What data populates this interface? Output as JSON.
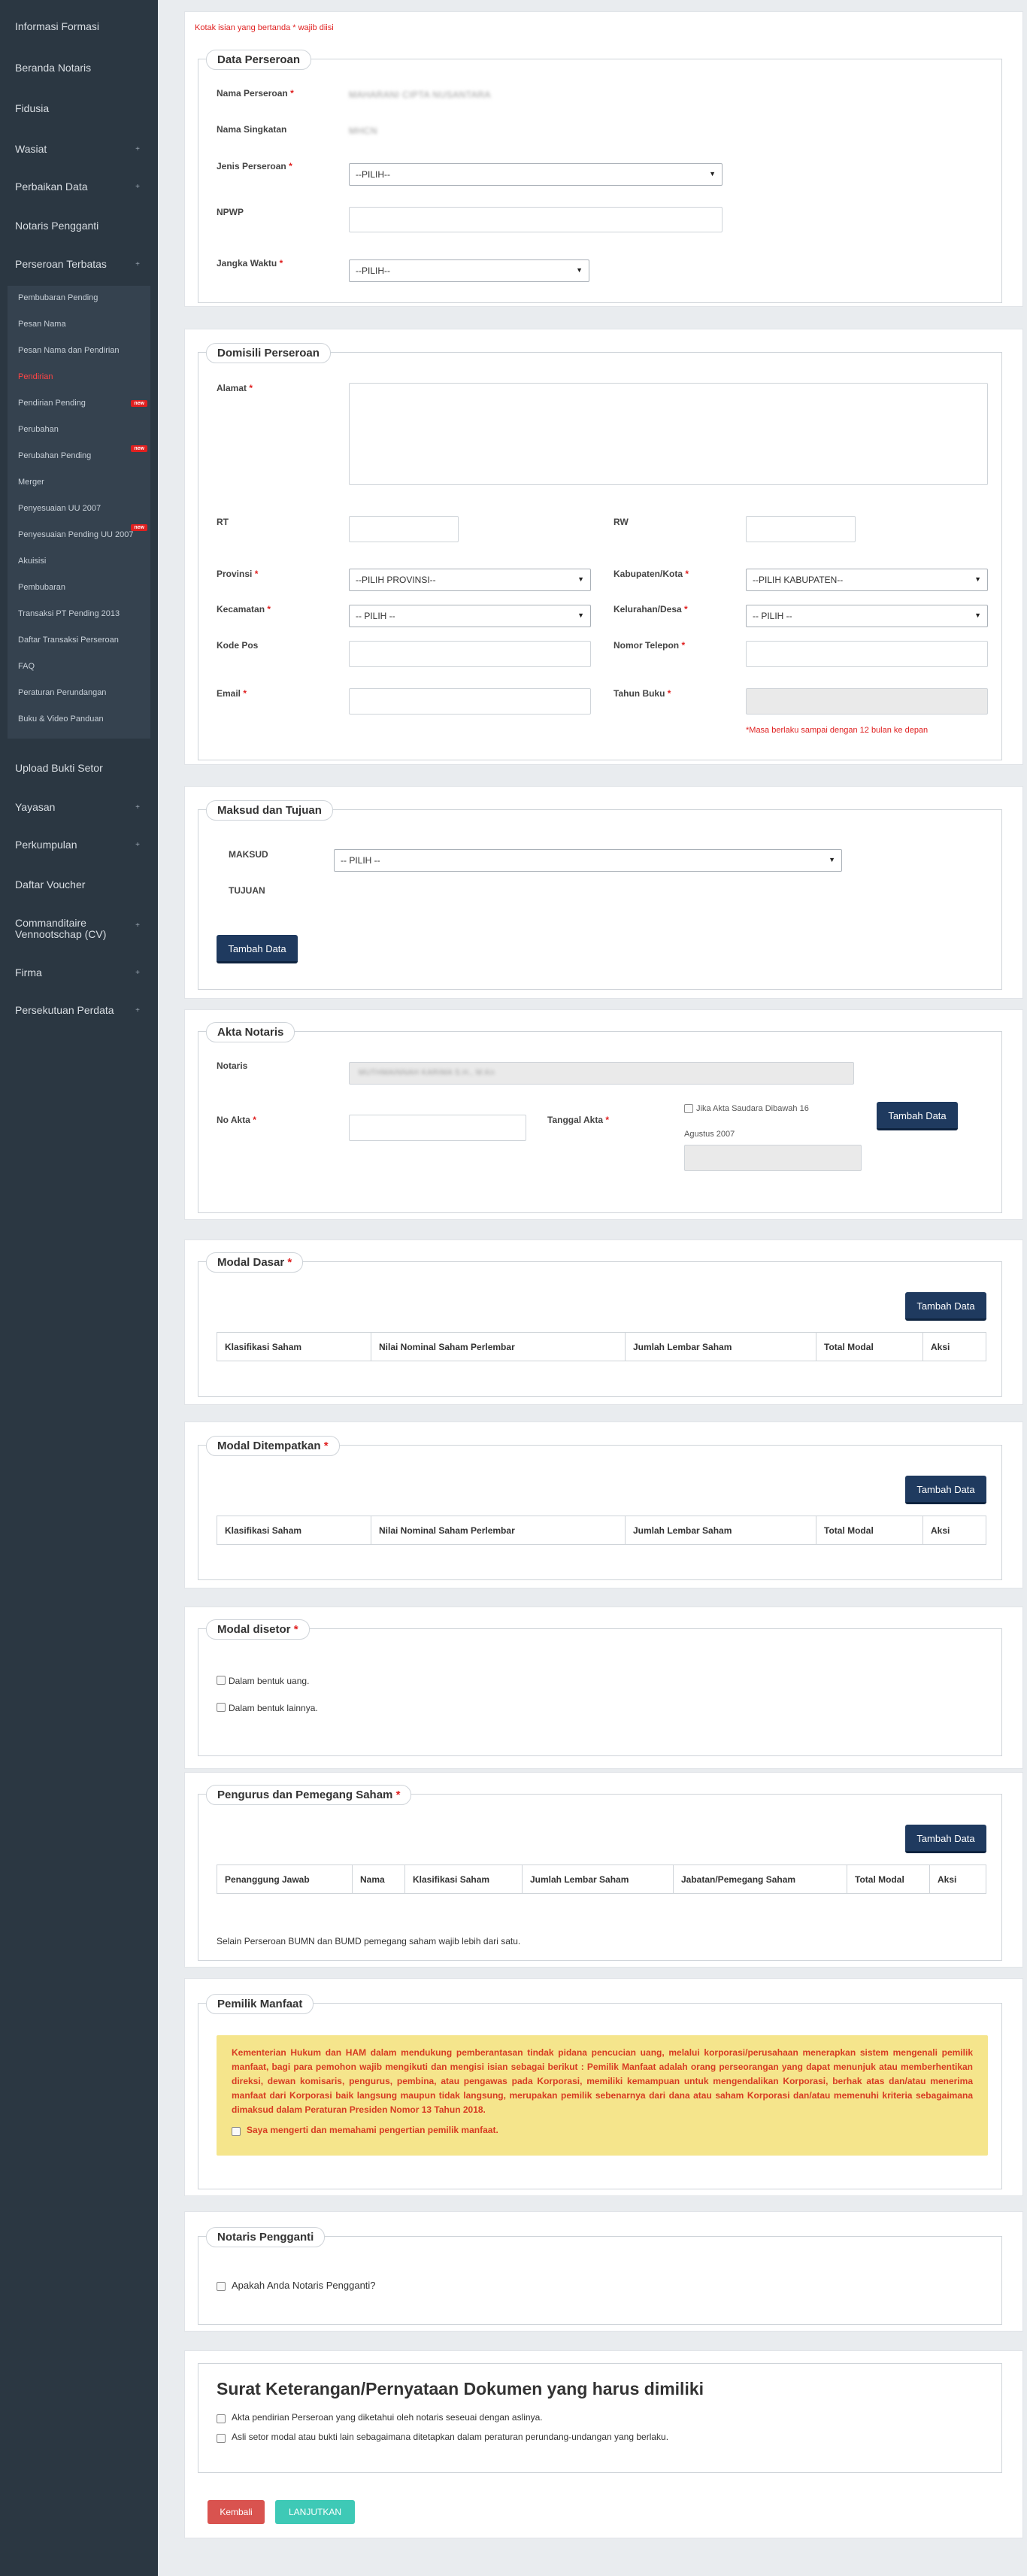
{
  "sidebar": {
    "items": [
      {
        "label": "Informasi Formasi",
        "chevron": false
      },
      {
        "label": "Beranda Notaris",
        "chevron": false
      },
      {
        "label": "Fidusia",
        "chevron": false
      },
      {
        "label": "Wasiat",
        "chevron": true
      },
      {
        "label": "Perbaikan Data",
        "chevron": true
      },
      {
        "label": "Notaris Pengganti",
        "chevron": false
      },
      {
        "label": "Perseroan Terbatas",
        "chevron": true
      }
    ],
    "submenu": [
      {
        "label": "Pembubaran Pending",
        "new": false,
        "active": false
      },
      {
        "label": "Pesan Nama",
        "new": false,
        "active": false
      },
      {
        "label": "Pesan Nama dan Pendirian",
        "new": false,
        "active": false
      },
      {
        "label": "Pendirian",
        "new": false,
        "active": true
      },
      {
        "label": "Pendirian Pending",
        "new": true,
        "active": false
      },
      {
        "label": "Perubahan",
        "new": false,
        "active": false
      },
      {
        "label": "Perubahan Pending",
        "new": true,
        "active": false
      },
      {
        "label": "Merger",
        "new": false,
        "active": false
      },
      {
        "label": "Penyesuaian UU 2007",
        "new": false,
        "active": false
      },
      {
        "label": "Penyesuaian Pending UU 2007",
        "new": true,
        "active": false
      },
      {
        "label": "Akuisisi",
        "new": false,
        "active": false
      },
      {
        "label": "Pembubaran",
        "new": false,
        "active": false
      },
      {
        "label": "Transaksi PT Pending 2013",
        "new": false,
        "active": false
      },
      {
        "label": "Daftar Transaksi Perseroan",
        "new": false,
        "active": false
      },
      {
        "label": "FAQ",
        "new": false,
        "active": false
      },
      {
        "label": "Peraturan Perundangan",
        "new": false,
        "active": false
      },
      {
        "label": "Buku & Video Panduan",
        "new": false,
        "active": false
      }
    ],
    "badge_label": "new",
    "items_after": [
      {
        "label": "Upload Bukti Setor",
        "chevron": false
      },
      {
        "label": "Yayasan",
        "chevron": true
      },
      {
        "label": "Perkumpulan",
        "chevron": true
      },
      {
        "label": "Daftar Voucher",
        "chevron": false
      },
      {
        "label": "Commanditaire Vennootschap (CV)",
        "chevron": true
      },
      {
        "label": "Firma",
        "chevron": true
      },
      {
        "label": "Persekutuan Perdata",
        "chevron": true
      }
    ]
  },
  "form": {
    "required_note": "Kotak isian yang bertanda * wajib diisi",
    "data_perseroan": {
      "legend": "Data Perseroan",
      "nama_label": "Nama Perseroan",
      "nama_value": "MAHARANI CIPTA NUSANTARA",
      "singkatan_label": "Nama Singkatan",
      "singkatan_value": "MHCN",
      "jenis_label": "Jenis Perseroan",
      "jenis_value": "--PILIH--",
      "npwp_label": "NPWP",
      "jangka_label": "Jangka Waktu",
      "jangka_value": "--PILIH--"
    },
    "domisili": {
      "legend": "Domisili Perseroan",
      "alamat_label": "Alamat",
      "rt_label": "RT",
      "rw_label": "RW",
      "provinsi_label": "Provinsi",
      "provinsi_value": "--PILIH PROVINSI--",
      "kabupaten_label": "Kabupaten/Kota",
      "kabupaten_value": "--PILIH KABUPATEN--",
      "kecamatan_label": "Kecamatan",
      "kecamatan_value": "-- PILIH --",
      "kelurahan_label": "Kelurahan/Desa",
      "kelurahan_value": "-- PILIH --",
      "kodepos_label": "Kode Pos",
      "telepon_label": "Nomor Telepon",
      "email_label": "Email",
      "tahunbuku_label": "Tahun Buku",
      "tahunbuku_note": "*Masa berlaku sampai dengan 12 bulan ke depan"
    },
    "maksud": {
      "legend": "Maksud dan Tujuan",
      "maksud_label": "MAKSUD",
      "maksud_value": "-- PILIH --",
      "tujuan_label": "TUJUAN",
      "add_button": "Tambah Data"
    },
    "akta": {
      "legend": "Akta Notaris",
      "notaris_label": "Notaris",
      "notaris_value": "MUTHMAINNAH KARIMA S.H., M.Kn",
      "noakta_label": "No Akta",
      "tanggal_label": "Tanggal Akta",
      "checkbox_label_line1": "Jika Akta Saudara Dibawah 16",
      "checkbox_label_line2": "Agustus 2007",
      "add_button": "Tambah Data"
    },
    "modal_dasar": {
      "legend": "Modal Dasar",
      "add_button": "Tambah Data",
      "columns": [
        "Klasifikasi Saham",
        "Nilai Nominal Saham Perlembar",
        "Jumlah Lembar Saham",
        "Total Modal",
        "Aksi"
      ]
    },
    "modal_ditempatkan": {
      "legend": "Modal Ditempatkan",
      "add_button": "Tambah Data",
      "columns": [
        "Klasifikasi Saham",
        "Nilai Nominal Saham Perlembar",
        "Jumlah Lembar Saham",
        "Total Modal",
        "Aksi"
      ]
    },
    "modal_disetor": {
      "legend": "Modal disetor",
      "opt_uang": "Dalam bentuk uang.",
      "opt_lainnya": "Dalam bentuk lainnya."
    },
    "pengurus": {
      "legend": "Pengurus dan Pemegang Saham",
      "add_button": "Tambah Data",
      "columns": [
        "Penanggung Jawab",
        "Nama",
        "Klasifikasi Saham",
        "Jumlah Lembar Saham",
        "Jabatan/Pemegang Saham",
        "Total Modal",
        "Aksi"
      ],
      "note": "Selain Perseroan BUMN dan BUMD pemegang saham wajib lebih dari satu."
    },
    "pemilik_manfaat": {
      "legend": "Pemilik Manfaat",
      "warning": "Kementerian Hukum dan HAM dalam mendukung pemberantasan tindak pidana pencucian uang, melalui korporasi/perusahaan menerapkan sistem mengenali pemilik manfaat, bagi para pemohon wajib mengikuti dan mengisi isian sebagai berikut : Pemilik Manfaat adalah orang perseorangan yang dapat menunjuk atau memberhentikan direksi, dewan komisaris, pengurus, pembina, atau pengawas pada Korporasi, memiliki kemampuan untuk mengendalikan Korporasi, berhak atas dan/atau menerima manfaat dari Korporasi baik langsung maupun tidak langsung, merupakan pemilik sebenarnya dari dana atau saham Korporasi dan/atau memenuhi kriteria sebagaimana dimaksud dalam Peraturan Presiden Nomor 13 Tahun 2018.",
      "agree_label": "Saya mengerti dan memahami pengertian pemilik manfaat."
    },
    "notaris_pengganti": {
      "legend": "Notaris Pengganti",
      "question": "Apakah Anda Notaris Pengganti?"
    },
    "surat": {
      "title": "Surat Keterangan/Pernyataan Dokumen yang harus dimiliki",
      "item1": "Akta pendirian Perseroan yang diketahui oleh notaris seseuai dengan aslinya.",
      "item2": "Asli setor modal atau bukti lain sebagaimana ditetapkan dalam peraturan perundang-undangan yang berlaku."
    },
    "back_button": "Kembali",
    "next_button": "LANJUTKAN"
  },
  "colors": {
    "sidebar_bg": "#2b3742",
    "primary_button": "#1f3a5f",
    "required": "#e02020",
    "warning_bg": "#f5e58c",
    "back_button": "#d9534f",
    "next_button": "#3ec9b6"
  }
}
